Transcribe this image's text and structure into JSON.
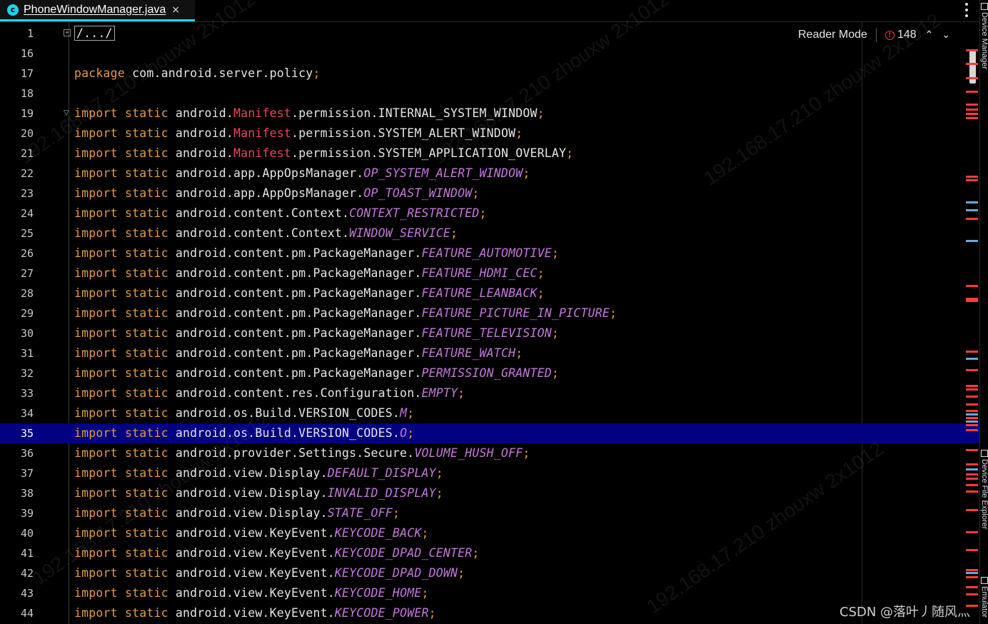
{
  "tab": {
    "icon_letter": "c",
    "title": "PhoneWindowManager.java",
    "close": "×"
  },
  "reader": {
    "label": "Reader Mode",
    "error_count": "148",
    "up": "⌃",
    "down": "⌄"
  },
  "tool_windows": [
    "Device Manager",
    "Device File Explorer",
    "Emulator"
  ],
  "active_line": "35",
  "colors": {
    "keyword": "#e89b40",
    "class_ref": "#f0455a",
    "constant": "#c678dd",
    "text": "#e6e6e6",
    "active_line_bg": "#000080",
    "tab_accent": "#22d3ee",
    "error": "#ff3b3b"
  },
  "lines": [
    {
      "n": "1",
      "folded": "/.../"
    },
    {
      "n": "16",
      "plain": ""
    },
    {
      "n": "17",
      "pkg": "com.android.server.policy"
    },
    {
      "n": "18",
      "plain": ""
    },
    {
      "n": "19",
      "path": "android.",
      "cls": "Manifest",
      "rest": ".permission.INTERNAL_SYSTEM_WINDOW",
      "c": ""
    },
    {
      "n": "20",
      "path": "android.",
      "cls": "Manifest",
      "rest": ".permission.SYSTEM_ALERT_WINDOW",
      "c": ""
    },
    {
      "n": "21",
      "path": "android.",
      "cls": "Manifest",
      "rest": ".permission.SYSTEM_APPLICATION_OVERLAY",
      "c": ""
    },
    {
      "n": "22",
      "path": "android.app.AppOpsManager.",
      "c": "OP_SYSTEM_ALERT_WINDOW"
    },
    {
      "n": "23",
      "path": "android.app.AppOpsManager.",
      "c": "OP_TOAST_WINDOW"
    },
    {
      "n": "24",
      "path": "android.content.Context.",
      "c": "CONTEXT_RESTRICTED"
    },
    {
      "n": "25",
      "path": "android.content.Context.",
      "c": "WINDOW_SERVICE"
    },
    {
      "n": "26",
      "path": "android.content.pm.PackageManager.",
      "c": "FEATURE_AUTOMOTIVE"
    },
    {
      "n": "27",
      "path": "android.content.pm.PackageManager.",
      "c": "FEATURE_HDMI_CEC"
    },
    {
      "n": "28",
      "path": "android.content.pm.PackageManager.",
      "c": "FEATURE_LEANBACK"
    },
    {
      "n": "29",
      "path": "android.content.pm.PackageManager.",
      "c": "FEATURE_PICTURE_IN_PICTURE"
    },
    {
      "n": "30",
      "path": "android.content.pm.PackageManager.",
      "c": "FEATURE_TELEVISION"
    },
    {
      "n": "31",
      "path": "android.content.pm.PackageManager.",
      "c": "FEATURE_WATCH"
    },
    {
      "n": "32",
      "path": "android.content.pm.PackageManager.",
      "c": "PERMISSION_GRANTED"
    },
    {
      "n": "33",
      "path": "android.content.res.Configuration.",
      "c": "EMPTY"
    },
    {
      "n": "34",
      "path": "android.os.Build.VERSION_CODES.",
      "c": "M"
    },
    {
      "n": "35",
      "path": "android.os.Build.VERSION_CODES.",
      "c": "O"
    },
    {
      "n": "36",
      "path": "android.provider.Settings.Secure.",
      "c": "VOLUME_HUSH_OFF"
    },
    {
      "n": "37",
      "path": "android.view.Display.",
      "c": "DEFAULT_DISPLAY"
    },
    {
      "n": "38",
      "path": "android.view.Display.",
      "c": "INVALID_DISPLAY"
    },
    {
      "n": "39",
      "path": "android.view.Display.",
      "c": "STATE_OFF"
    },
    {
      "n": "40",
      "path": "android.view.KeyEvent.",
      "c": "KEYCODE_BACK"
    },
    {
      "n": "41",
      "path": "android.view.KeyEvent.",
      "c": "KEYCODE_DPAD_CENTER"
    },
    {
      "n": "42",
      "path": "android.view.KeyEvent.",
      "c": "KEYCODE_DPAD_DOWN"
    },
    {
      "n": "43",
      "path": "android.view.KeyEvent.",
      "c": "KEYCODE_HOME"
    },
    {
      "n": "44",
      "path": "android.view.KeyEvent.",
      "c": "KEYCODE_POWER"
    }
  ],
  "keywords": {
    "package": "package",
    "import": "import",
    "static": "static"
  },
  "watermark": {
    "text": "192.168.17.210 zhouxw 2x1012",
    "csdn": "CSDN @落叶丿随风灬"
  }
}
